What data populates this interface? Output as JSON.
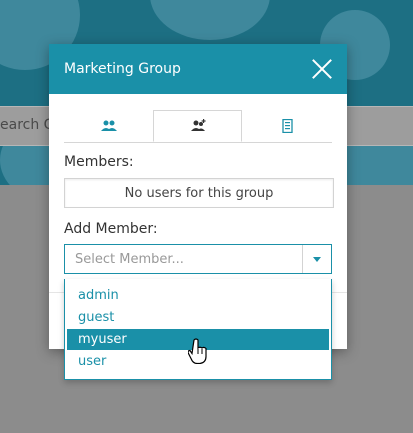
{
  "background": {
    "search_text": "earch G"
  },
  "dialog": {
    "title": "Marketing Group",
    "tabs": [
      {
        "name": "users-tab",
        "icon": "users-icon"
      },
      {
        "name": "add-member-tab",
        "icon": "user-add-icon",
        "active": true
      },
      {
        "name": "details-tab",
        "icon": "document-icon"
      }
    ],
    "members_label": "Members:",
    "members_empty": "No users for this group",
    "add_member_label": "Add Member:",
    "select_placeholder": "Select Member...",
    "options": [
      "admin",
      "guest",
      "myuser",
      "user"
    ],
    "highlighted_option": "myuser"
  },
  "colors": {
    "accent": "#1a90a8",
    "overlay": "#8c8c8c"
  }
}
